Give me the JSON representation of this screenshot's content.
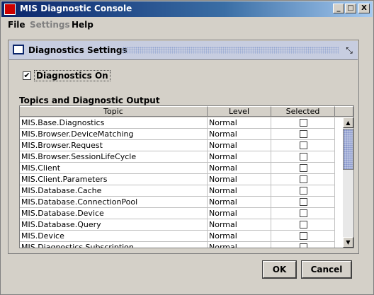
{
  "window": {
    "title": "MIS Diagnostic Console",
    "minimize": "_",
    "maximize": "□",
    "close": "X"
  },
  "menubar": {
    "items": [
      {
        "label": "File"
      },
      {
        "label": "Settings"
      },
      {
        "label": "Help"
      }
    ]
  },
  "panel": {
    "title": "Diagnostics Settings",
    "checkbox": {
      "label": "Diagnostics On",
      "checked": true,
      "mark": "✔"
    },
    "section_label": "Topics and Diagnostic Output",
    "table": {
      "headers": [
        "Topic",
        "Level",
        "Selected"
      ],
      "rows": [
        {
          "topic": "MIS.Base.Diagnostics",
          "level": "Normal"
        },
        {
          "topic": "MIS.Browser.DeviceMatching",
          "level": "Normal"
        },
        {
          "topic": "MIS.Browser.Request",
          "level": "Normal"
        },
        {
          "topic": "MIS.Browser.SessionLifeCycle",
          "level": "Normal"
        },
        {
          "topic": "MIS.Client",
          "level": "Normal"
        },
        {
          "topic": "MIS.Client.Parameters",
          "level": "Normal"
        },
        {
          "topic": "MIS.Database.Cache",
          "level": "Normal"
        },
        {
          "topic": "MIS.Database.ConnectionPool",
          "level": "Normal"
        },
        {
          "topic": "MIS.Database.Device",
          "level": "Normal"
        },
        {
          "topic": "MIS.Database.Query",
          "level": "Normal"
        },
        {
          "topic": "MIS.Device",
          "level": "Normal"
        },
        {
          "topic": "MIS.Diagnostics.Subscription",
          "level": "Normal"
        }
      ],
      "scroll_up": "▲",
      "scroll_down": "▼"
    }
  },
  "buttons": {
    "ok": "OK",
    "cancel": "Cancel"
  }
}
